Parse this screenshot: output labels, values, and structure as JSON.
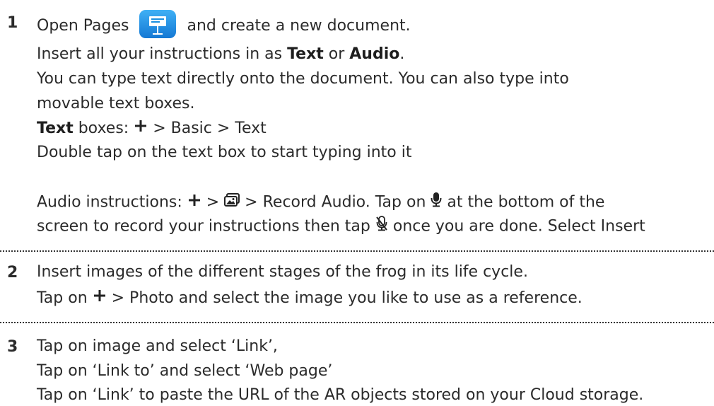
{
  "steps": [
    {
      "number": "1",
      "line1_pre": "Open Pages",
      "line1_post": "and create a new document.",
      "line2_pre": "Insert all your instructions in as ",
      "line2_b1": "Text",
      "line2_mid": " or ",
      "line2_b2": "Audio",
      "line2_end": ".",
      "line3": "You can type text directly onto the document. You can also type into",
      "line4": "movable text boxes.",
      "line5_b": "Text",
      "line5_pre": " boxes: ",
      "line5_post": " > Basic > Text",
      "line6": "Double tap on the text box to start typing into it",
      "line7_pre": "Audio instructions: ",
      "line7_mid": " > ",
      "line7_post": " > Record Audio. Tap on ",
      "line7_end": " at the bottom of the",
      "line8_pre": "screen to record your instructions then tap ",
      "line8_post": " once you are done. Select Insert"
    },
    {
      "number": "2",
      "line1": "Insert images of the different stages of the frog in its life cycle.",
      "line2_pre": "Tap on ",
      "line2_post": " > Photo and select the image you like to use as a reference."
    },
    {
      "number": "3",
      "line1": "Tap on image and select ‘Link’,",
      "line2": "Tap on ‘Link to’ and select ‘Web page’",
      "line3": "Tap on ‘Link’ to paste the URL of the AR objects stored on your Cloud storage."
    }
  ],
  "icons": {
    "pages": "pages-app-icon",
    "plus": "plus-icon",
    "media": "media-icon",
    "mic": "microphone-icon",
    "mic_off": "microphone-off-icon"
  },
  "colors": {
    "text": "#2b2b2b",
    "pages_blue": "#1a8fe0"
  }
}
